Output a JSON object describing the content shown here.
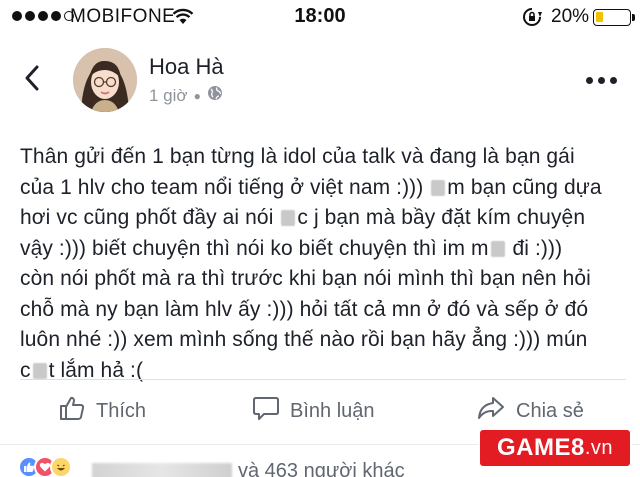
{
  "status_bar": {
    "carrier": "MOBIFONE",
    "time": "18:00",
    "battery_percent": "20%",
    "battery_level": 0.2,
    "signal_bars_filled": 4,
    "signal_bars_total": 5
  },
  "post": {
    "author": "Hoa Hà",
    "time_ago": "1 giờ",
    "audience_icon": "globe-icon",
    "lines": [
      [
        "Thân gửi đến 1 bạn từng là idol của talk và đang là bạn gái"
      ],
      [
        "của 1 hlv cho team nổi tiếng ở việt nam :))) ",
        "",
        "m bạn cũng dựa"
      ],
      [
        "hơi vc cũng phốt đầy ai nói ",
        "",
        "c j bạn mà bầy đặt kím chuyện"
      ],
      [
        "vậy :))) biết chuyện thì nói ko biết chuyện thì im m",
        "",
        " đi :)))"
      ],
      [
        "còn nói phốt mà ra thì trước khi bạn nói mình thì bạn nên hỏi"
      ],
      [
        "chỗ mà ny bạn làm hlv ấy :))) hỏi tất cả mn ở đó và sếp ở đó"
      ],
      [
        "luôn nhé :)) xem mình sống thế nào rồi bạn hãy ẳng :))) mún"
      ],
      [
        "c",
        "",
        "t lắm hả :("
      ]
    ]
  },
  "actions": {
    "like": "Thích",
    "comment": "Bình luận",
    "share": "Chia sẻ"
  },
  "reactions": {
    "summary_suffix": "và 463 người khác",
    "types": [
      "like",
      "love",
      "haha"
    ],
    "colors": {
      "like": "#5890ff",
      "love": "#f25268",
      "haha": "#fcd669"
    }
  },
  "watermark": {
    "brand": "GAME8",
    "suffix": ".vn"
  }
}
